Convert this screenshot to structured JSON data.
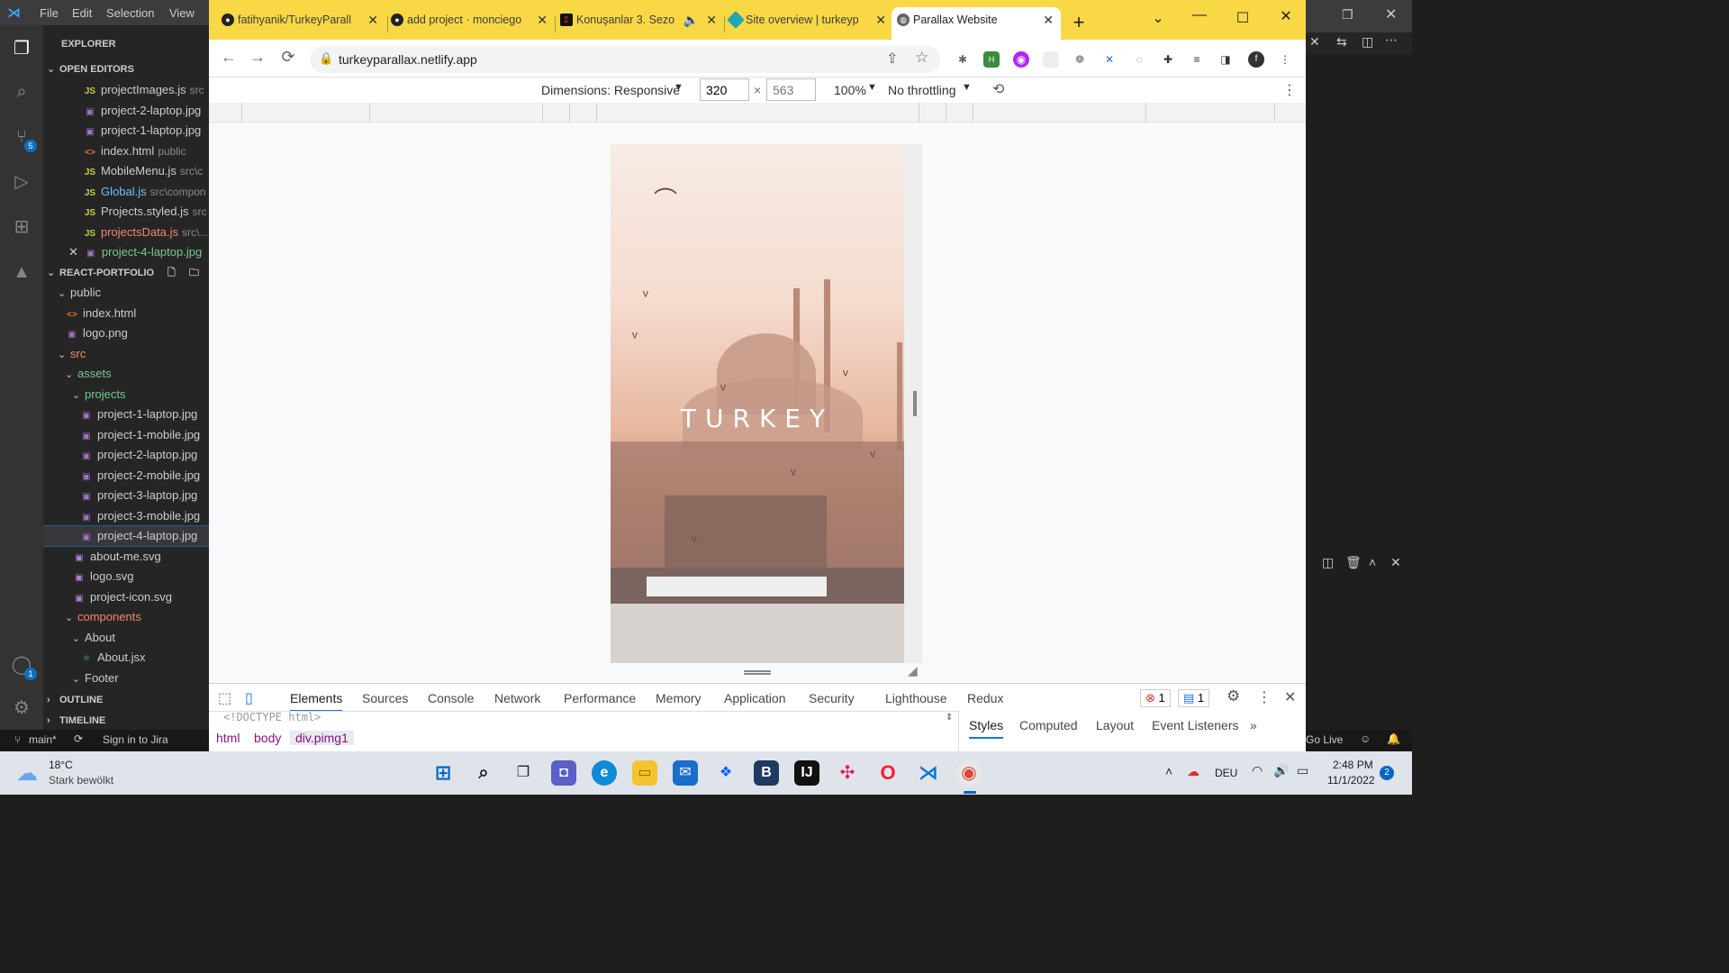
{
  "vscode": {
    "menu": [
      "File",
      "Edit",
      "Selection",
      "View"
    ],
    "explorer_title": "EXPLORER",
    "open_editors_title": "OPEN EDITORS",
    "open_editors": [
      {
        "icon": "JS",
        "name": "projectImages.js",
        "path": "src"
      },
      {
        "icon": "IMG",
        "name": "project-2-laptop.jpg",
        "path": ""
      },
      {
        "icon": "IMG",
        "name": "project-1-laptop.jpg",
        "path": ""
      },
      {
        "icon": "<>",
        "name": "index.html",
        "path": "public"
      },
      {
        "icon": "JS",
        "name": "MobileMenu.js",
        "path": "src\\c"
      },
      {
        "icon": "JS",
        "name": "Global.js",
        "path": "src\\compon"
      },
      {
        "icon": "JS",
        "name": "Projects.styled.js",
        "path": "src"
      },
      {
        "icon": "JS",
        "name": "projectsData.js",
        "path": "src\\..."
      },
      {
        "icon": "IMG",
        "name": "project-4-laptop.jpg",
        "path": ""
      }
    ],
    "project_title": "REACT-PORTFOLIO",
    "tree": [
      {
        "depth": 1,
        "type": "folder",
        "name": "public"
      },
      {
        "depth": 2,
        "type": "html",
        "name": "index.html"
      },
      {
        "depth": 2,
        "type": "img",
        "name": "logo.png"
      },
      {
        "depth": 1,
        "type": "folder",
        "name": "src"
      },
      {
        "depth": 2,
        "type": "folder",
        "name": "assets"
      },
      {
        "depth": 3,
        "type": "folder",
        "name": "projects"
      },
      {
        "depth": 4,
        "type": "img",
        "name": "project-1-laptop.jpg"
      },
      {
        "depth": 4,
        "type": "img",
        "name": "project-1-mobile.jpg"
      },
      {
        "depth": 4,
        "type": "img",
        "name": "project-2-laptop.jpg"
      },
      {
        "depth": 4,
        "type": "img",
        "name": "project-2-mobile.jpg"
      },
      {
        "depth": 4,
        "type": "img",
        "name": "project-3-laptop.jpg"
      },
      {
        "depth": 4,
        "type": "img",
        "name": "project-3-mobile.jpg"
      },
      {
        "depth": 4,
        "type": "img",
        "name": "project-4-laptop.jpg"
      },
      {
        "depth": 3,
        "type": "svg",
        "name": "about-me.svg"
      },
      {
        "depth": 3,
        "type": "svg",
        "name": "logo.svg"
      },
      {
        "depth": 3,
        "type": "svg",
        "name": "project-icon.svg"
      },
      {
        "depth": 2,
        "type": "folder",
        "name": "components"
      },
      {
        "depth": 3,
        "type": "folder",
        "name": "About"
      },
      {
        "depth": 4,
        "type": "jsx",
        "name": "About.jsx"
      },
      {
        "depth": 3,
        "type": "folder",
        "name": "Footer"
      }
    ],
    "outline_title": "OUTLINE",
    "timeline_title": "TIMELINE",
    "status": {
      "branch": "main*",
      "jira": "Sign in to Jira",
      "golive": "Go Live"
    },
    "badges": {
      "source_control": "5",
      "accounts": "1"
    }
  },
  "chrome": {
    "tabs": [
      {
        "title": "fatihyanik/TurkeyParall",
        "icon": "github-icon"
      },
      {
        "title": "add project · monciego",
        "icon": "github-icon"
      },
      {
        "title": "Konuşanlar 3. Sezo",
        "icon": "blutv-icon"
      },
      {
        "title": "Site overview | turkeyp",
        "icon": "netlify-icon"
      },
      {
        "title": "Parallax Website",
        "icon": "globe-icon"
      }
    ],
    "url": "turkeyparallax.netlify.app",
    "devbar": {
      "dimensions": "Dimensions: Responsive",
      "width": "320",
      "height": "563",
      "zoom": "100%",
      "throttle": "No throttling"
    },
    "page": {
      "title": "TURKEY"
    },
    "devtools": {
      "tabs": [
        "Elements",
        "Sources",
        "Console",
        "Network",
        "Performance",
        "Memory",
        "Application",
        "Security",
        "Lighthouse",
        "Redux"
      ],
      "errors": "1",
      "messages": "1",
      "doctype": "<!DOCTYPE html>",
      "breadcrumbs": [
        "html",
        "body",
        "div.pimg1"
      ],
      "side_tabs": [
        "Styles",
        "Computed",
        "Layout",
        "Event Listeners",
        "»"
      ]
    }
  },
  "taskbar": {
    "weather_temp": "18°C",
    "weather_desc": "Stark bewölkt",
    "lang": "DEU",
    "time": "2:48 PM",
    "date": "11/1/2022",
    "notifications": "2"
  }
}
